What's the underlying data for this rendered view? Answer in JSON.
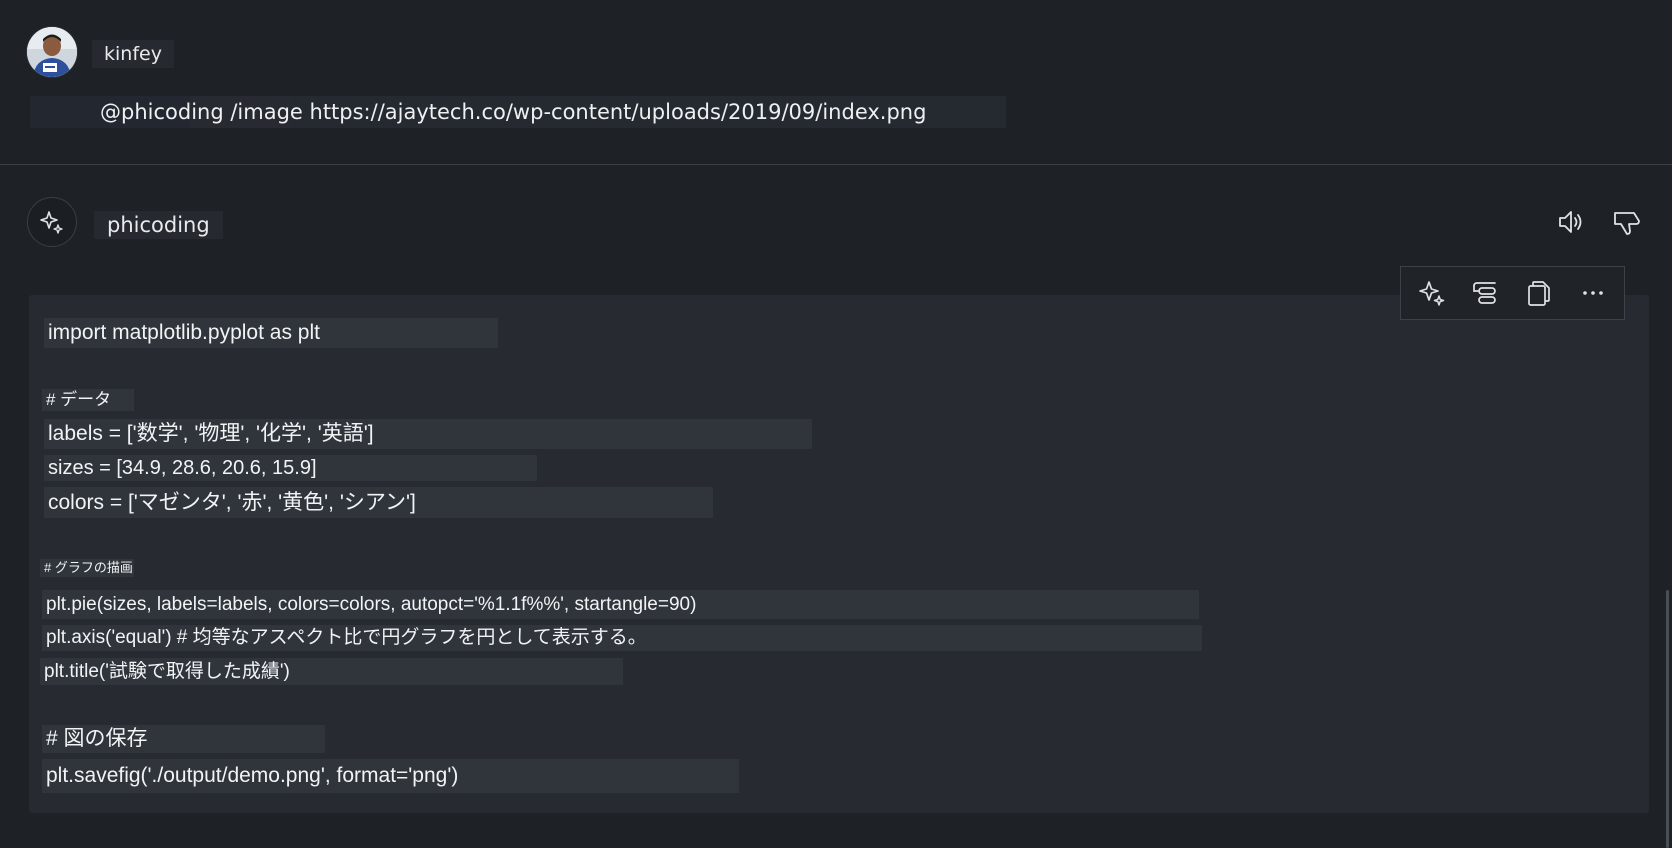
{
  "user": {
    "name": "kinfey",
    "prompt": "@phicoding /image https://ajaytech.co/wp-content/uploads/2019/09/index.png"
  },
  "bot": {
    "name": "phicoding"
  },
  "icons": {
    "user_avatar": "user-photo-avatar",
    "bot_avatar": "sparkle-icon",
    "read_aloud": "speaker-icon",
    "dislike": "thumbs-down-icon",
    "apply": "sparkle-icon",
    "insert": "insert-at-cursor-icon",
    "copy": "copy-icon",
    "more": "more-icon"
  },
  "code_lines": [
    "import matplotlib.pyplot as plt",
    "# データ",
    "labels = ['数学', '物理', '化学', '英語']",
    "sizes = [34.9, 28.6, 20.6, 15.9]",
    "colors = ['マゼンタ', '赤', '黄色', 'シアン']",
    "# グラフの描画",
    "plt.pie(sizes, labels=labels, colors=colors, autopct='%1.1f%%', startangle=90)",
    "plt.axis('equal') # 均等なアスペクト比で円グラフを円として表示する。",
    "plt.title('試験で取得した成績')",
    "# 図の保存",
    "plt.savefig('./output/demo.png', format='png')"
  ],
  "colors": {
    "background": "#1e2227",
    "code_panel": "#272b31",
    "line_highlight": "#30353b",
    "text": "#f1f3f5"
  }
}
